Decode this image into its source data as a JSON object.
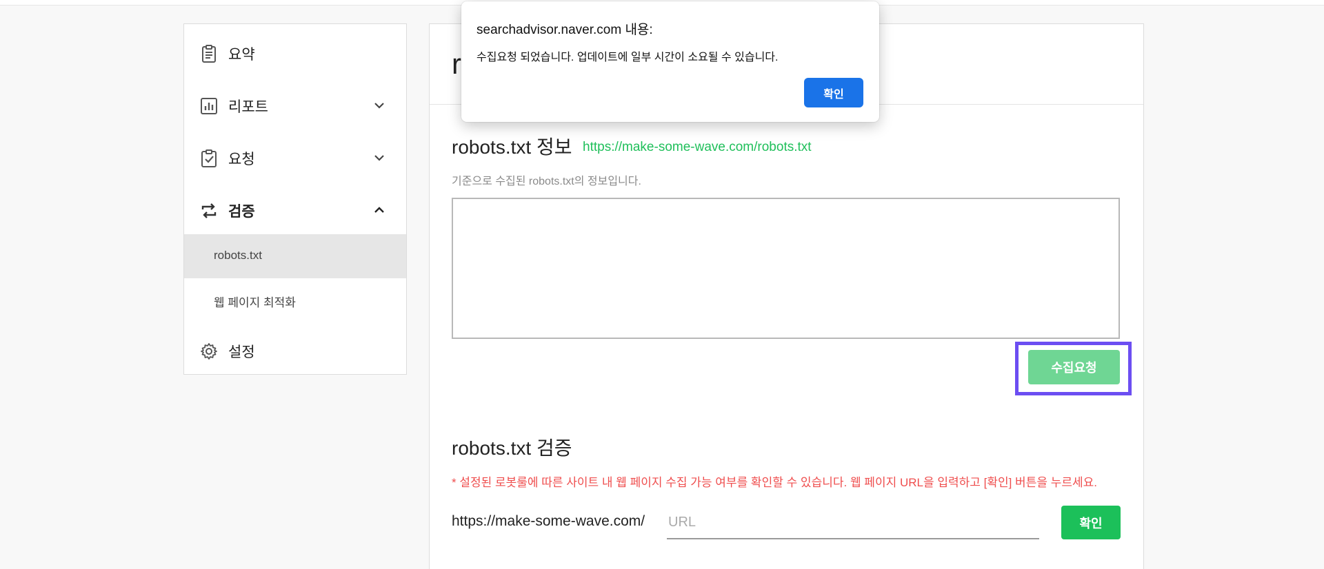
{
  "sidebar": {
    "items": [
      {
        "label": "요약",
        "icon": "clipboard-icon"
      },
      {
        "label": "리포트",
        "icon": "bar-chart-icon"
      },
      {
        "label": "요청",
        "icon": "checklist-icon"
      },
      {
        "label": "검증",
        "icon": "repeat-arrows-icon"
      },
      {
        "label": "설정",
        "icon": "gear-icon"
      }
    ],
    "subitems": [
      {
        "label": "robots.txt",
        "active": true
      },
      {
        "label": "웹 페이지 최적화",
        "active": false
      }
    ]
  },
  "main": {
    "title_partial": "r",
    "robots_info": {
      "title": "robots.txt 정보",
      "link": "https://make-some-wave.com/robots.txt",
      "desc": "기준으로 수집된 robots.txt의 정보입니다.",
      "content": "",
      "collect_button": "수집요청"
    },
    "robots_verify": {
      "title": "robots.txt 검증",
      "warning": "* 설정된 로봇룰에 따른 사이트 내 웹 페이지 수집 가능 여부를 확인할 수 있습니다. 웹 페이지 URL을 입력하고 [확인] 버튼을 누르세요.",
      "base_url": "https://make-some-wave.com/",
      "url_placeholder": "URL",
      "confirm_button": "확인"
    }
  },
  "dialog": {
    "title": "searchadvisor.naver.com 내용:",
    "message": "수집요청 되었습니다. 업데이트에 일부 시간이 소요될 수 있습니다.",
    "ok_button": "확인"
  },
  "colors": {
    "accent_green": "#1cc05a",
    "disabled_green": "#6fd694",
    "warning_red": "#ef4d4d",
    "highlight_purple": "#6c4ef2",
    "dialog_blue": "#1a73e8"
  }
}
